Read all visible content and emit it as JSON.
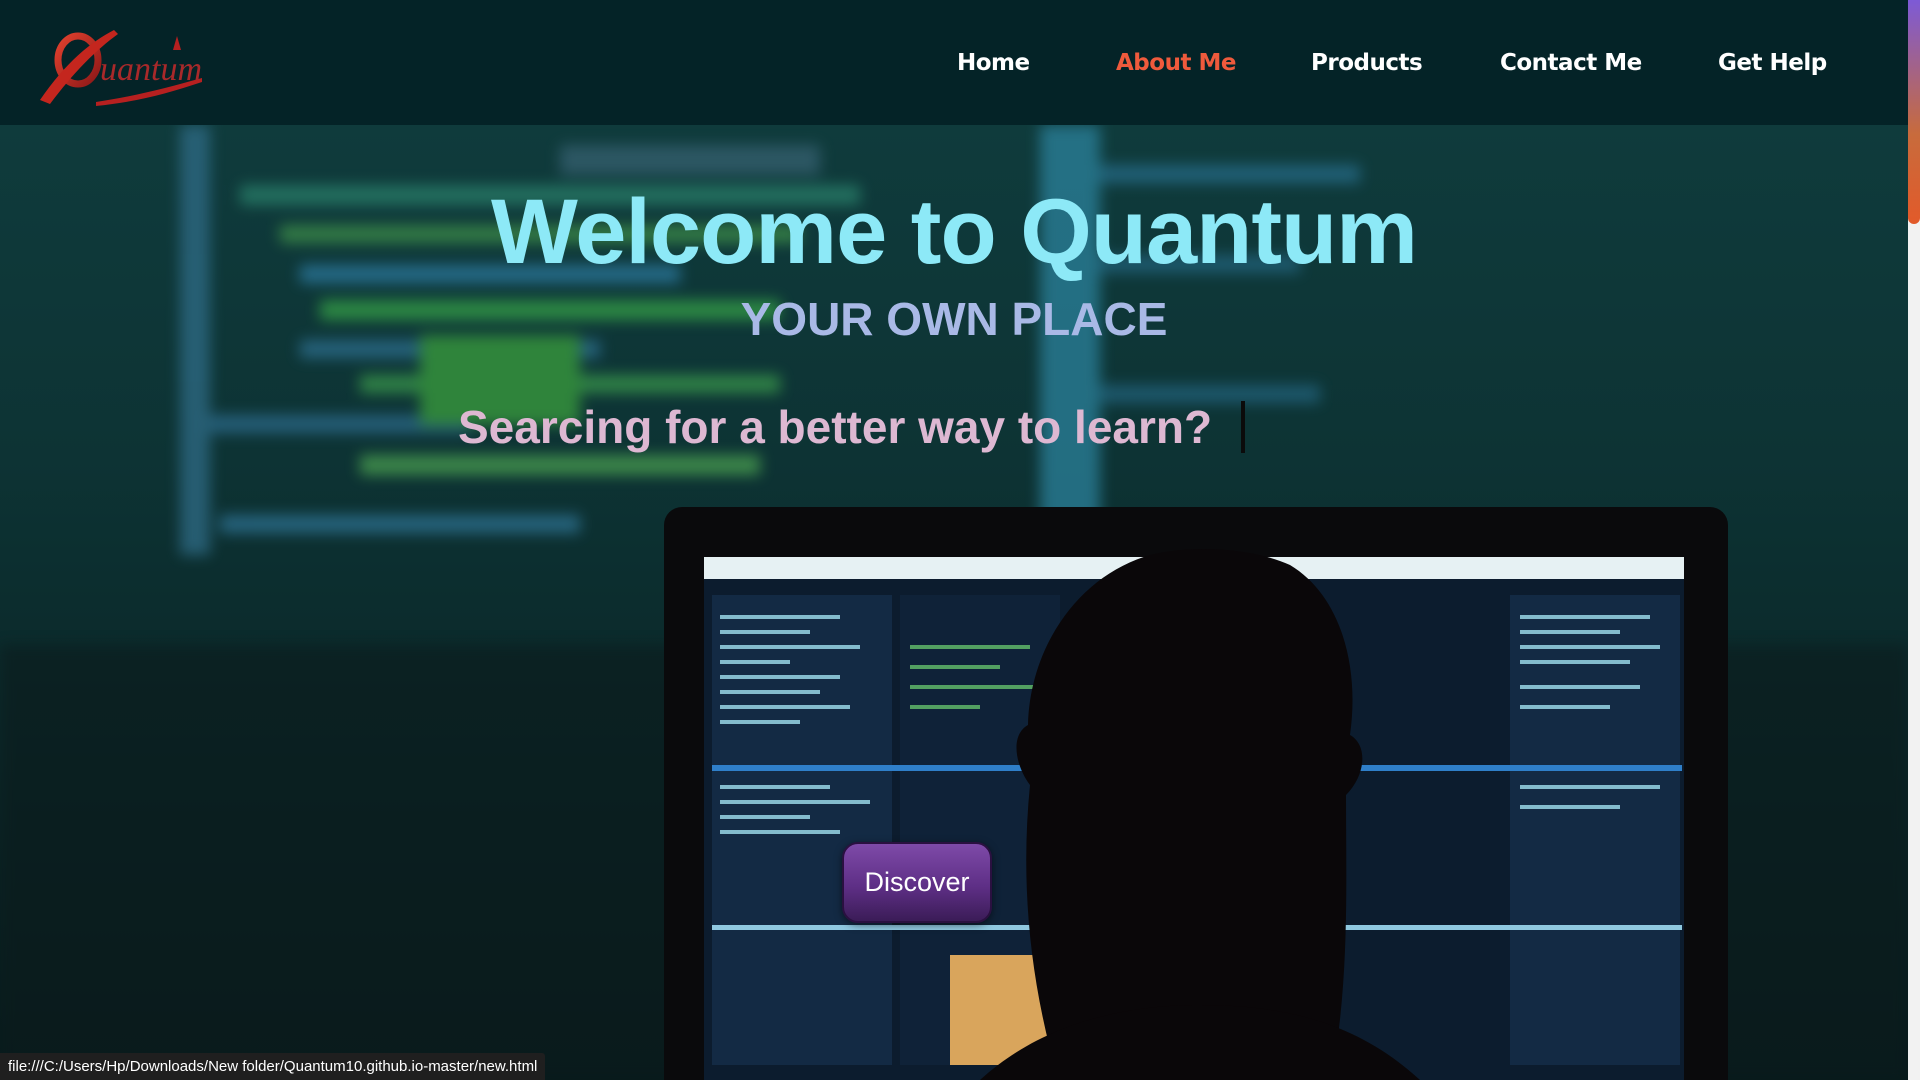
{
  "brand": {
    "logo_text": "Quantum"
  },
  "nav": {
    "items": [
      {
        "label": "Home"
      },
      {
        "label": "About Me",
        "active": true
      },
      {
        "label": "Products"
      },
      {
        "label": "Contact Me"
      },
      {
        "label": "Get Help"
      }
    ]
  },
  "hero": {
    "title": "Welcome to Quantum",
    "subtitle": "YOUR OWN PLACE",
    "typing_text": "Searcing for a better way to learn?",
    "cta_label": "Discover"
  },
  "status_bar": {
    "url": "file:///C:/Users/Hp/Downloads/New folder/Quantum10.github.io-master/new.html"
  },
  "colors": {
    "header_bg": "#042327",
    "nav_active": "#ef5a3c",
    "title": "#8de9f7",
    "subtitle": "#a9b9e6",
    "typing": "#ddb8d2",
    "button": "#6b3a96"
  },
  "icons": {
    "logo": "quantum-logo-red-swoosh"
  }
}
